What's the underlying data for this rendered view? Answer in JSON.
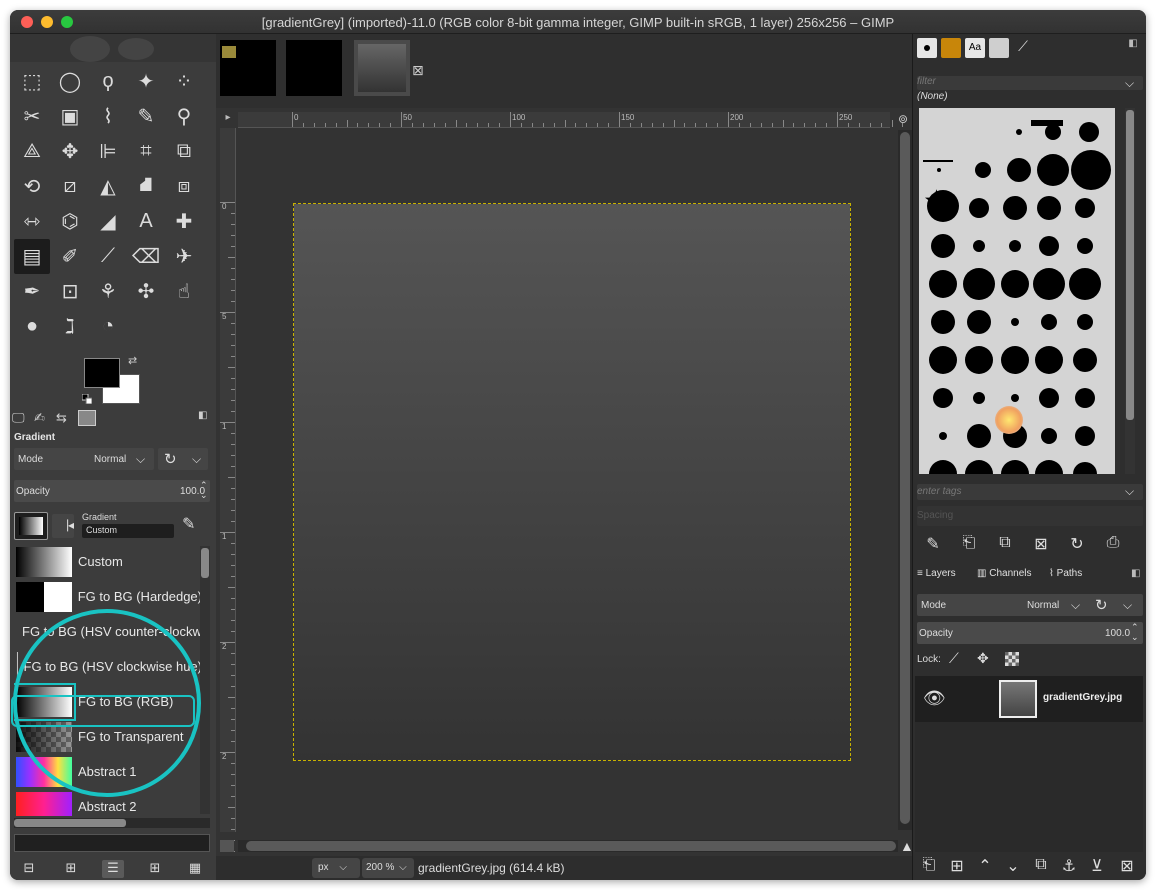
{
  "window": {
    "title": "[gradientGrey] (imported)-11.0 (RGB color 8-bit gamma integer, GIMP built-in sRGB, 1 layer) 256x256 – GIMP"
  },
  "toolbox": {
    "tools": [
      {
        "name": "rect-select-icon",
        "glyph": "⬚"
      },
      {
        "name": "ellipse-select-icon",
        "glyph": "◯"
      },
      {
        "name": "free-select-icon",
        "glyph": "ϙ"
      },
      {
        "name": "fuzzy-select-icon",
        "glyph": "✦"
      },
      {
        "name": "select-by-color-icon",
        "glyph": "⁘"
      },
      {
        "name": "scissors-icon",
        "glyph": "✂"
      },
      {
        "name": "foreground-select-icon",
        "glyph": "▣"
      },
      {
        "name": "paths-icon",
        "glyph": "⌇"
      },
      {
        "name": "color-picker-icon",
        "glyph": "✎"
      },
      {
        "name": "zoom-icon",
        "glyph": "⚲"
      },
      {
        "name": "measure-icon",
        "glyph": "⟁"
      },
      {
        "name": "move-icon",
        "glyph": "✥"
      },
      {
        "name": "align-icon",
        "glyph": "⊫"
      },
      {
        "name": "crop-icon",
        "glyph": "⌗"
      },
      {
        "name": "unified-transform-icon",
        "glyph": "⧉"
      },
      {
        "name": "rotate-icon",
        "glyph": "⟲"
      },
      {
        "name": "shear-icon",
        "glyph": "⧄"
      },
      {
        "name": "perspective-icon",
        "glyph": "◭"
      },
      {
        "name": "3d-transform-icon",
        "glyph": "⛘"
      },
      {
        "name": "cage-transform-icon",
        "glyph": "⧈"
      },
      {
        "name": "flip-icon",
        "glyph": "⇿"
      },
      {
        "name": "warp-icon",
        "glyph": "⌬"
      },
      {
        "name": "bucket-fill-icon",
        "glyph": "◢"
      },
      {
        "name": "text-icon",
        "glyph": "A"
      },
      {
        "name": "heal-icon",
        "glyph": "✚"
      },
      {
        "name": "gradient-icon",
        "glyph": "▤",
        "active": true
      },
      {
        "name": "pencil-icon",
        "glyph": "✐"
      },
      {
        "name": "paintbrush-icon",
        "glyph": "⟋"
      },
      {
        "name": "eraser-icon",
        "glyph": "⌫"
      },
      {
        "name": "airbrush-icon",
        "glyph": "✈"
      },
      {
        "name": "ink-icon",
        "glyph": "✒"
      },
      {
        "name": "mypaint-brush-icon",
        "glyph": "⊡"
      },
      {
        "name": "clone-icon",
        "glyph": "⚘"
      },
      {
        "name": "perspective-clone-icon",
        "glyph": "✣"
      },
      {
        "name": "smudge-icon",
        "glyph": "☝"
      },
      {
        "name": "blur-sharpen-icon",
        "glyph": "●"
      },
      {
        "name": "dodge-burn-icon",
        "glyph": "ℷ"
      },
      {
        "name": "smudge2-icon",
        "glyph": "◔"
      }
    ]
  },
  "tool_options": {
    "panel_title": "Gradient",
    "mode_label": "Mode",
    "mode_value": "Normal",
    "opacity_label": "Opacity",
    "opacity_value": "100.0",
    "gradient_label": "Gradient",
    "gradient_name": "Custom"
  },
  "gradients": [
    {
      "label": "Custom",
      "swatch": "sw-custom"
    },
    {
      "label": "FG to BG (Hardedge)",
      "swatch": "sw-hard"
    },
    {
      "label": "FG to BG (HSV counter-clockwise)",
      "swatch": "sw-hsv"
    },
    {
      "label": "FG to BG (HSV clockwise hue)",
      "swatch": "sw-hsv"
    },
    {
      "label": "FG to BG (RGB)",
      "swatch": "sw-rgb",
      "selected": true
    },
    {
      "label": "FG to Transparent",
      "swatch": "sw-trans"
    },
    {
      "label": "Abstract 1",
      "swatch": "sw-abs1"
    },
    {
      "label": "Abstract 2",
      "swatch": "sw-abs2"
    }
  ],
  "rulers": {
    "top": [
      "0",
      "50",
      "100",
      "150",
      "200",
      "250"
    ],
    "left": [
      "0",
      "5",
      "1",
      "1",
      "2",
      "2"
    ]
  },
  "statusbar": {
    "unit": "px",
    "zoom": "200 %",
    "file_info": "gradientGrey.jpg (614.4 kB)"
  },
  "brushes": {
    "filter_placeholder": "filter",
    "selected": "(None)",
    "tags_placeholder": "enter tags",
    "spacing_label": "Spacing"
  },
  "layers": {
    "tabs": [
      "Layers",
      "Channels",
      "Paths"
    ],
    "mode_label": "Mode",
    "mode_value": "Normal",
    "opacity_label": "Opacity",
    "opacity_value": "100.0",
    "lock_label": "Lock:",
    "layer_name": "gradientGrey.jpg"
  },
  "colors": {
    "accent_highlight": "#19c3c3",
    "fg": "#000000",
    "bg": "#ffffff"
  }
}
